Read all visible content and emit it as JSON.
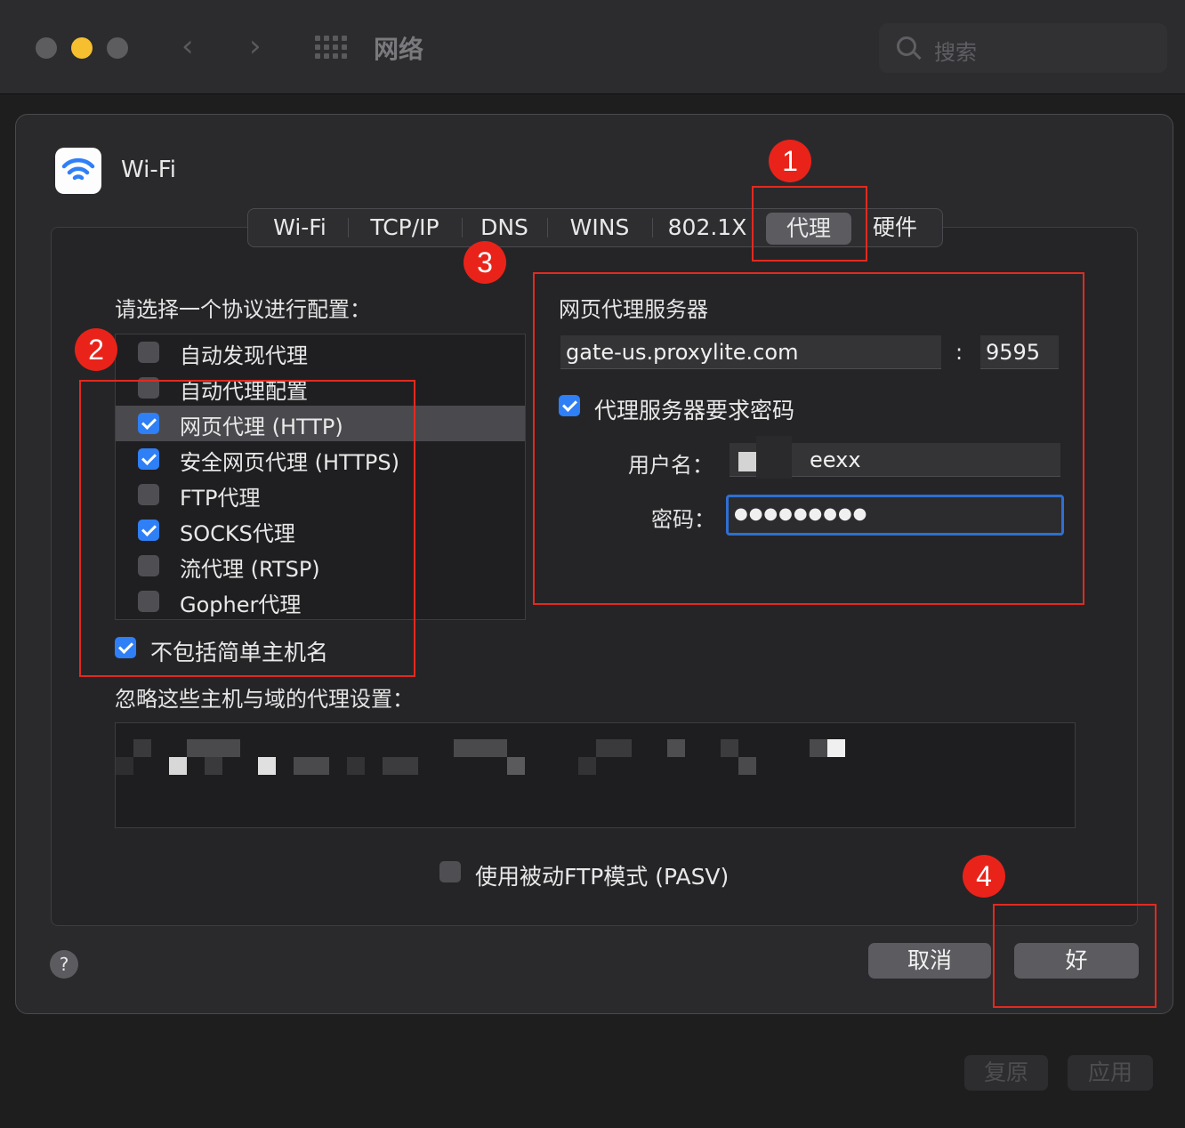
{
  "window": {
    "title": "网络",
    "search_placeholder": "搜索"
  },
  "interface": {
    "name": "Wi-Fi"
  },
  "tabs": [
    {
      "label": "Wi-Fi"
    },
    {
      "label": "TCP/IP"
    },
    {
      "label": "DNS"
    },
    {
      "label": "WINS"
    },
    {
      "label": "802.1X"
    },
    {
      "label": "代理",
      "active": true
    },
    {
      "label": "硬件"
    }
  ],
  "protocols": {
    "heading": "请选择一个协议进行配置：",
    "items": [
      {
        "label": "自动发现代理",
        "checked": false
      },
      {
        "label": "自动代理配置",
        "checked": false
      },
      {
        "label": "网页代理 (HTTP)",
        "checked": true,
        "selected": true
      },
      {
        "label": "安全网页代理 (HTTPS)",
        "checked": true
      },
      {
        "label": "FTP代理",
        "checked": false
      },
      {
        "label": "SOCKS代理",
        "checked": true
      },
      {
        "label": "流代理 (RTSP)",
        "checked": false
      },
      {
        "label": "Gopher代理",
        "checked": false
      }
    ]
  },
  "exclude_simple": {
    "label": "不包括简单主机名",
    "checked": true
  },
  "bypass": {
    "heading": "忽略这些主机与域的代理设置："
  },
  "proxy_server": {
    "heading": "网页代理服务器",
    "host": "gate-us.proxylite.com",
    "port": "9595",
    "requires_password_label": "代理服务器要求密码",
    "requires_password": true,
    "username_label": "用户名：",
    "username_value": "eexx",
    "password_label": "密码：",
    "password_value": "●●●●●●●●●"
  },
  "passive_ftp": {
    "label": "使用被动FTP模式 (PASV)",
    "checked": false
  },
  "buttons": {
    "help": "?",
    "cancel": "取消",
    "ok": "好",
    "revert": "复原",
    "apply": "应用"
  },
  "annotations": [
    "1",
    "2",
    "3",
    "4"
  ],
  "colors": {
    "accent": "#2f7ff6",
    "annotation_red": "#e12a1f",
    "focus_ring": "#2f6fd0"
  }
}
